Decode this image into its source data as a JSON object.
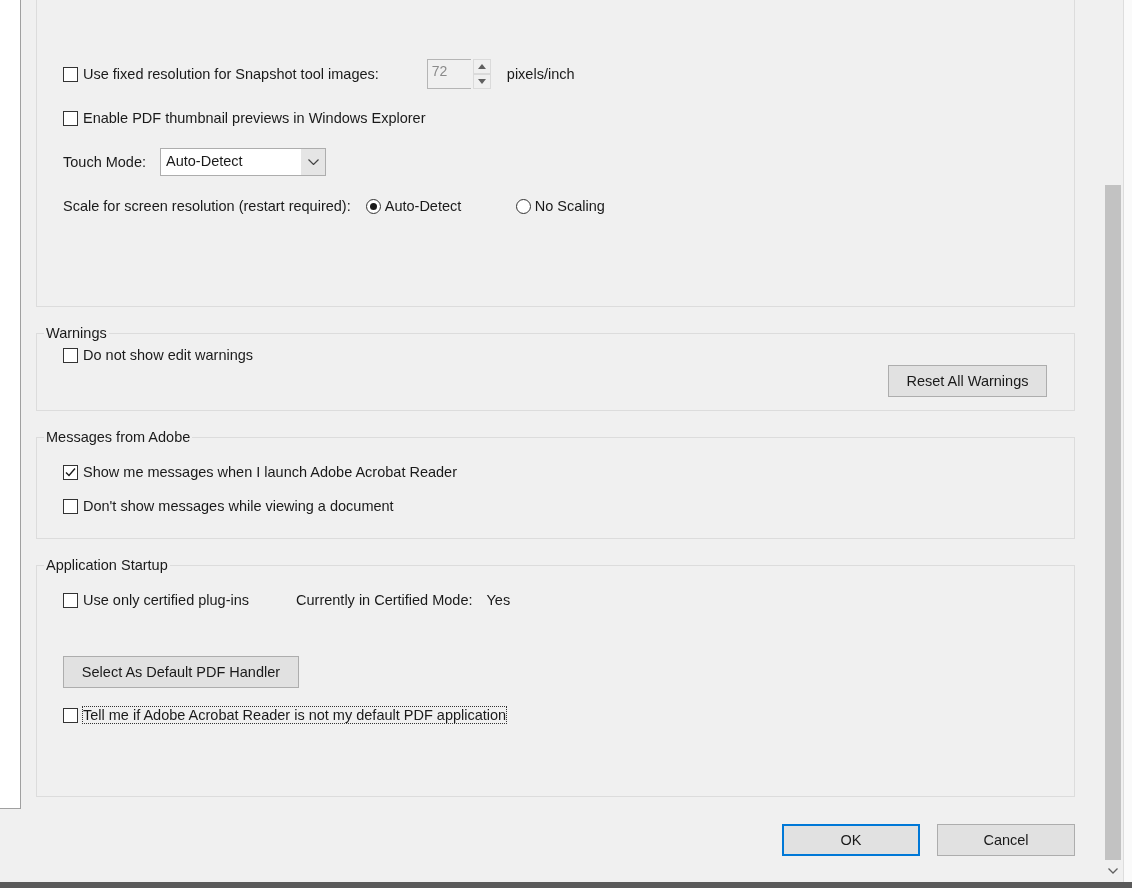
{
  "general": {
    "snapshot_resolution": {
      "label": "Use fixed resolution for Snapshot tool images:",
      "checked": false,
      "value": "72",
      "disabled": true,
      "unit": "pixels/inch"
    },
    "thumbnail_previews": {
      "label": "Enable PDF thumbnail previews in Windows Explorer",
      "checked": false
    },
    "touch_mode": {
      "label": "Touch Mode:",
      "value": "Auto-Detect"
    },
    "scale": {
      "label": "Scale for screen resolution (restart required):",
      "options": [
        {
          "label": "Auto-Detect",
          "selected": true
        },
        {
          "label": "No Scaling",
          "selected": false
        }
      ]
    }
  },
  "warnings": {
    "title": "Warnings",
    "checkbox": {
      "label": "Do not show edit warnings",
      "checked": false
    },
    "button": "Reset All Warnings"
  },
  "messages": {
    "title": "Messages from Adobe",
    "checkboxes": [
      {
        "label": "Show me messages when I launch Adobe Acrobat Reader",
        "checked": true
      },
      {
        "label": "Don't show messages while viewing a document",
        "checked": false
      }
    ]
  },
  "startup": {
    "title": "Application Startup",
    "certified": {
      "label": "Use only certified plug-ins",
      "checked": false
    },
    "status_label": "Currently in Certified Mode:",
    "status_value": "Yes",
    "button": "Select As Default PDF Handler",
    "default_check": {
      "label": "Tell me if Adobe Acrobat Reader is not my default PDF application",
      "checked": false,
      "focused": true
    }
  },
  "footer": {
    "buttons": [
      {
        "label": "OK",
        "default": true
      },
      {
        "label": "Cancel",
        "default": false
      }
    ]
  }
}
